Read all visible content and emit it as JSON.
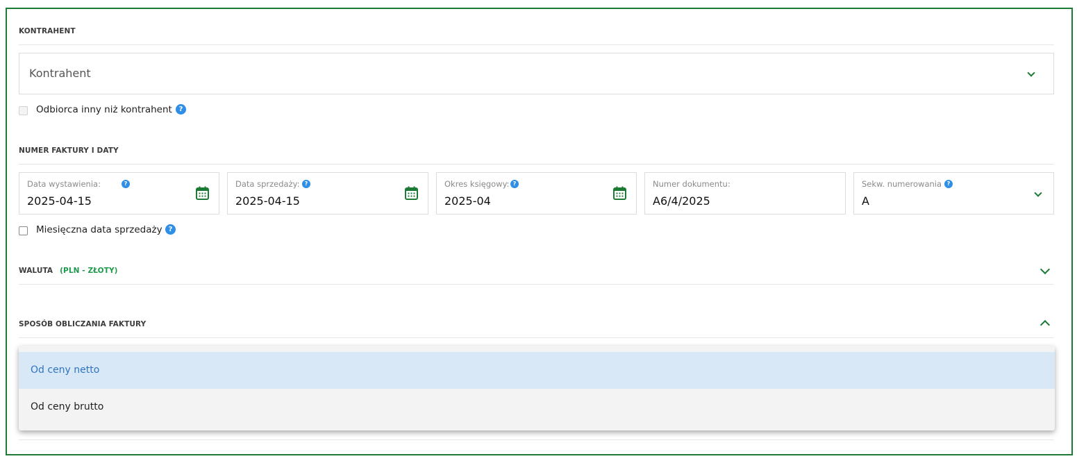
{
  "kontrahent": {
    "section_title": "KONTRAHENT",
    "select_placeholder": "Kontrahent",
    "checkbox_label": "Odbiorca inny niż kontrahent",
    "help_glyph": "?"
  },
  "numbers": {
    "section_title": "NUMER FAKTURY I DATY",
    "fields": [
      {
        "label": "Data wystawienia:",
        "value": "2025-04-15",
        "icon": "calendar-icon"
      },
      {
        "label": "Data sprzedaży:",
        "value": "2025-04-15",
        "icon": "calendar-icon"
      },
      {
        "label": "Okres księgowy:",
        "value": "2025-04",
        "icon": "calendar-icon"
      },
      {
        "label": "Numer dokumentu:",
        "value": "A6/4/2025"
      },
      {
        "label": "Sekw. numerowania",
        "value": "A",
        "icon": "chevron-down-icon"
      }
    ],
    "monthly_label": "Miesięczna data sprzedaży"
  },
  "waluta": {
    "title": "WALUTA",
    "value": "(PLN - ZŁOTY)"
  },
  "calc": {
    "title": "SPOSÓB OBLICZANIA FAKTURY",
    "options": [
      "Od ceny netto",
      "Od ceny brutto"
    ],
    "selected": "Od ceny netto"
  },
  "colors": {
    "accent_green": "#1d7a35",
    "help_blue": "#2f8ee6",
    "selected_bg": "#d8e8f7",
    "selected_text": "#2f73c2"
  }
}
